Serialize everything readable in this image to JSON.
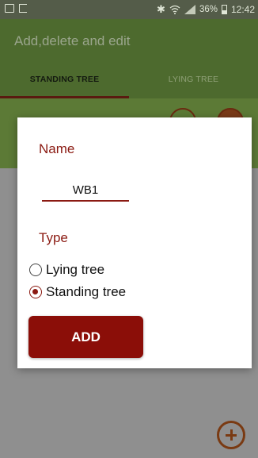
{
  "status_bar": {
    "battery_percent": "36%",
    "time": "12:42",
    "icons": [
      "notification-icon",
      "screenshot-icon",
      "bluetooth-icon",
      "wifi-icon",
      "signal-icon",
      "battery-icon"
    ]
  },
  "app_bar": {
    "title": "Add,delete and edit"
  },
  "tabs": [
    {
      "label": "STANDING TREE",
      "selected": true
    },
    {
      "label": "LYING TREE",
      "selected": false
    }
  ],
  "dialog": {
    "name_label": "Name",
    "name_value": "WB1",
    "type_label": "Type",
    "options": [
      {
        "label": "Lying tree",
        "checked": false
      },
      {
        "label": "Standing tree",
        "checked": true
      }
    ],
    "add_label": "ADD"
  },
  "colors": {
    "primary": "#4d6a2e",
    "accent": "#8b1a12",
    "button": "#8b0e08"
  }
}
